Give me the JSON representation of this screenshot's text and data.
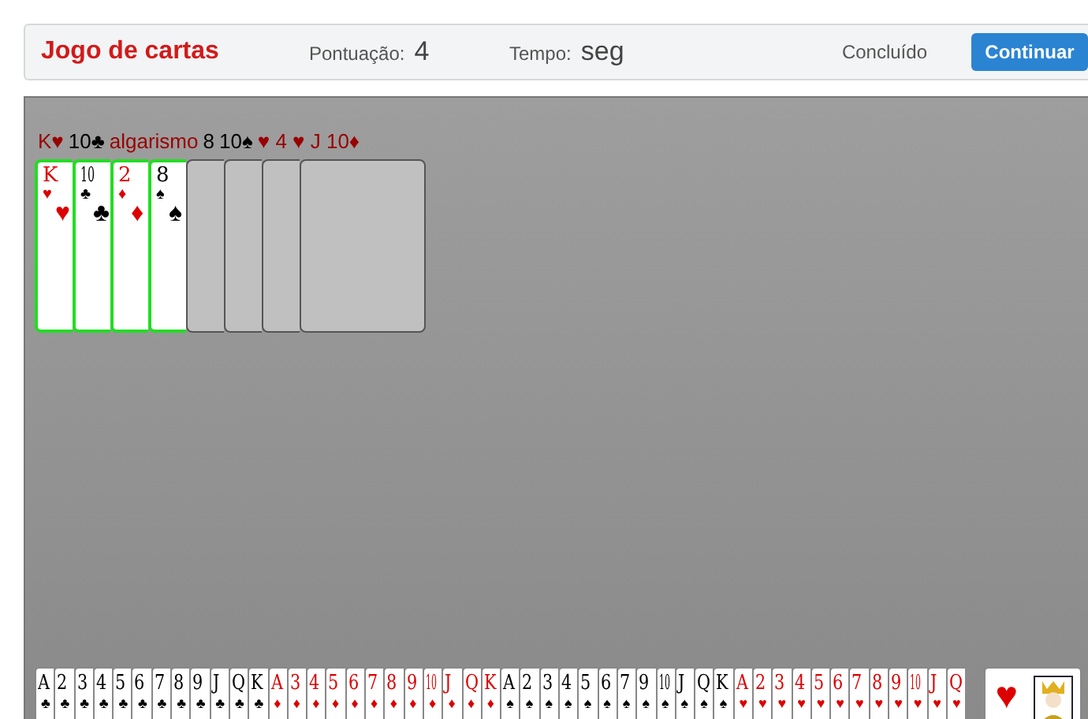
{
  "header": {
    "title": "Jogo de cartas",
    "score_label": "Pontuação:",
    "score": "4",
    "time_label": "Tempo:",
    "time": "seg",
    "status": "Concluído",
    "button": "Continuar"
  },
  "labels": [
    {
      "text": "K♥",
      "color": "#990000"
    },
    {
      "text": "10♣",
      "color": "#000000"
    },
    {
      "text": "algarismo",
      "color": "#990000"
    },
    {
      "text": "8",
      "color": "#000000"
    },
    {
      "text": "10♠",
      "color": "#000000"
    },
    {
      "text": "♥ 4 ♥ J 10♦",
      "color": "#990000"
    }
  ],
  "hand": [
    {
      "kind": "face",
      "rank": "K",
      "suit": "♥",
      "color": "#dd0000",
      "selected": true
    },
    {
      "kind": "face",
      "rank": "10",
      "suit": "♣",
      "color": "#000000",
      "selected": true
    },
    {
      "kind": "face",
      "rank": "2",
      "suit": "♦",
      "color": "#dd0000",
      "selected": true
    },
    {
      "kind": "face",
      "rank": "8",
      "suit": "♠",
      "color": "#000000",
      "selected": true
    },
    {
      "kind": "back",
      "selected": false
    },
    {
      "kind": "back",
      "selected": false
    },
    {
      "kind": "back",
      "selected": false
    },
    {
      "kind": "back",
      "selected": false
    }
  ],
  "deck": [
    {
      "rank": "A",
      "suit": "♣",
      "color": "#000000"
    },
    {
      "rank": "2",
      "suit": "♣",
      "color": "#000000"
    },
    {
      "rank": "3",
      "suit": "♣",
      "color": "#000000"
    },
    {
      "rank": "4",
      "suit": "♣",
      "color": "#000000"
    },
    {
      "rank": "5",
      "suit": "♣",
      "color": "#000000"
    },
    {
      "rank": "6",
      "suit": "♣",
      "color": "#000000"
    },
    {
      "rank": "7",
      "suit": "♣",
      "color": "#000000"
    },
    {
      "rank": "8",
      "suit": "♣",
      "color": "#000000"
    },
    {
      "rank": "9",
      "suit": "♣",
      "color": "#000000"
    },
    {
      "rank": "J",
      "suit": "♣",
      "color": "#000000"
    },
    {
      "rank": "Q",
      "suit": "♣",
      "color": "#000000"
    },
    {
      "rank": "K",
      "suit": "♣",
      "color": "#000000"
    },
    {
      "rank": "A",
      "suit": "♦",
      "color": "#dd0000"
    },
    {
      "rank": "3",
      "suit": "♦",
      "color": "#dd0000"
    },
    {
      "rank": "4",
      "suit": "♦",
      "color": "#dd0000"
    },
    {
      "rank": "5",
      "suit": "♦",
      "color": "#dd0000"
    },
    {
      "rank": "6",
      "suit": "♦",
      "color": "#dd0000"
    },
    {
      "rank": "7",
      "suit": "♦",
      "color": "#dd0000"
    },
    {
      "rank": "8",
      "suit": "♦",
      "color": "#dd0000"
    },
    {
      "rank": "9",
      "suit": "♦",
      "color": "#dd0000"
    },
    {
      "rank": "10",
      "suit": "♦",
      "color": "#dd0000"
    },
    {
      "rank": "J",
      "suit": "♦",
      "color": "#dd0000"
    },
    {
      "rank": "Q",
      "suit": "♦",
      "color": "#dd0000"
    },
    {
      "rank": "K",
      "suit": "♦",
      "color": "#dd0000"
    },
    {
      "rank": "A",
      "suit": "♠",
      "color": "#000000"
    },
    {
      "rank": "2",
      "suit": "♠",
      "color": "#000000"
    },
    {
      "rank": "3",
      "suit": "♠",
      "color": "#000000"
    },
    {
      "rank": "4",
      "suit": "♠",
      "color": "#000000"
    },
    {
      "rank": "5",
      "suit": "♠",
      "color": "#000000"
    },
    {
      "rank": "6",
      "suit": "♠",
      "color": "#000000"
    },
    {
      "rank": "7",
      "suit": "♠",
      "color": "#000000"
    },
    {
      "rank": "9",
      "suit": "♠",
      "color": "#000000"
    },
    {
      "rank": "10",
      "suit": "♠",
      "color": "#000000"
    },
    {
      "rank": "J",
      "suit": "♠",
      "color": "#000000"
    },
    {
      "rank": "Q",
      "suit": "♠",
      "color": "#000000"
    },
    {
      "rank": "K",
      "suit": "♠",
      "color": "#000000"
    },
    {
      "rank": "A",
      "suit": "♥",
      "color": "#dd0000"
    },
    {
      "rank": "2",
      "suit": "♥",
      "color": "#dd0000"
    },
    {
      "rank": "3",
      "suit": "♥",
      "color": "#dd0000"
    },
    {
      "rank": "4",
      "suit": "♥",
      "color": "#dd0000"
    },
    {
      "rank": "5",
      "suit": "♥",
      "color": "#dd0000"
    },
    {
      "rank": "6",
      "suit": "♥",
      "color": "#dd0000"
    },
    {
      "rank": "7",
      "suit": "♥",
      "color": "#dd0000"
    },
    {
      "rank": "8",
      "suit": "♥",
      "color": "#dd0000"
    },
    {
      "rank": "9",
      "suit": "♥",
      "color": "#dd0000"
    },
    {
      "rank": "10",
      "suit": "♥",
      "color": "#dd0000"
    },
    {
      "rank": "J",
      "suit": "♥",
      "color": "#dd0000"
    },
    {
      "rank": "Q",
      "suit": "♥",
      "color": "#dd0000"
    }
  ],
  "top_card": {
    "suit": "♥",
    "color": "#dd0000"
  }
}
